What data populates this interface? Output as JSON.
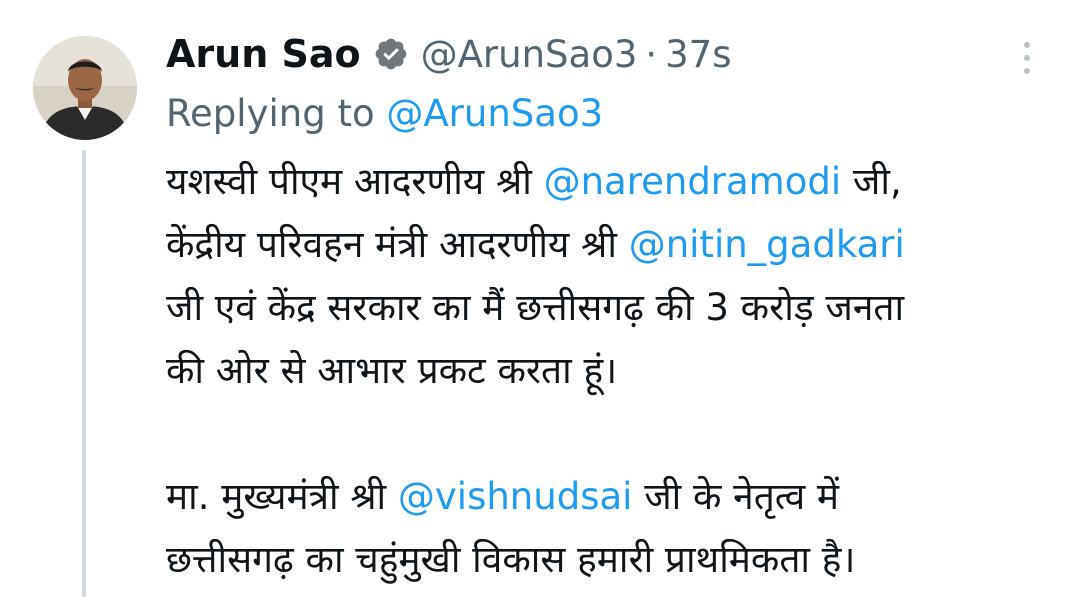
{
  "author": {
    "name": "Arun Sao",
    "handle": "@ArunSao3",
    "separator": "·",
    "time": "37s",
    "verified_icon": "verified-badge-icon"
  },
  "reply": {
    "prefix": "Replying to ",
    "mention": "@ArunSao3"
  },
  "body": {
    "p1_line1_text": "यशस्वी पीएम आदरणीय श्री ",
    "p1_line1_mention": "@narendramodi",
    "p1_line1_end": " जी,",
    "p1_line2_text": "केंद्रीय परिवहन मंत्री आदरणीय श्री ",
    "p1_line2_mention": "@nitin_gadkari",
    "p1_line3": "जी एवं केंद्र सरकार का मैं छत्तीसगढ़ की 3 करोड़ जनता",
    "p1_line4": "की ओर से आभार प्रकट करता हूं।",
    "p2_line1_text": "मा. मुख्यमंत्री श्री ",
    "p2_line1_mention": "@vishnudsai",
    "p2_line1_end": " जी के नेतृत्व में",
    "p2_line2": "छत्तीसगढ़ का चहुंमुखी विकास हमारी प्राथमिकता है।"
  },
  "colors": {
    "text": "#0f1419",
    "secondary": "#536471",
    "link": "#1d9bf0",
    "thread": "#cfd9de"
  },
  "icons": {
    "more": "more-vertical-icon",
    "avatar": "profile-photo"
  }
}
